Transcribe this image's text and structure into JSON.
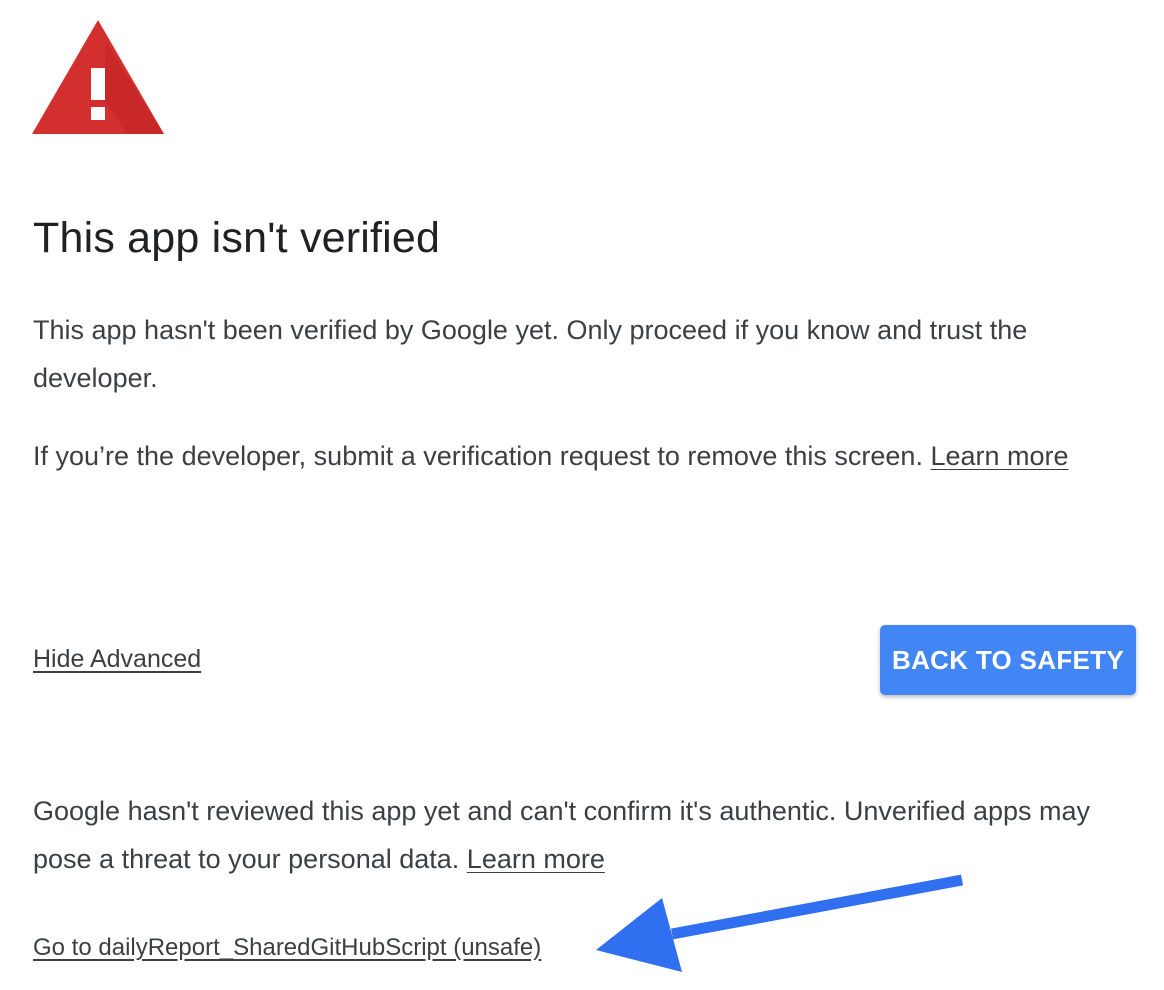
{
  "page": {
    "title": "This app isn't verified",
    "paragraph_1": "This app hasn't been verified by Google yet. Only proceed if you know and trust the developer.",
    "paragraph_2_text": "If you’re the developer, submit a verification request to remove this screen.",
    "paragraph_2_link": "Learn more",
    "paragraph_3_text": "Google hasn't reviewed this app yet and can't confirm it's authentic. Unverified apps may pose a threat to your personal data.",
    "paragraph_3_link": "Learn more"
  },
  "actions": {
    "hide_advanced": "Hide Advanced",
    "back_to_safety": "BACK TO SAFETY",
    "go_unsafe": "Go to dailyReport_SharedGitHubScript (unsafe)"
  },
  "icons": {
    "warning": "warning-triangle-icon",
    "annotation": "arrow-annotation-icon"
  },
  "colors": {
    "warning_red": "#d32f2f",
    "button_blue": "#4285f4",
    "annotation_blue": "#2f6ff0"
  }
}
